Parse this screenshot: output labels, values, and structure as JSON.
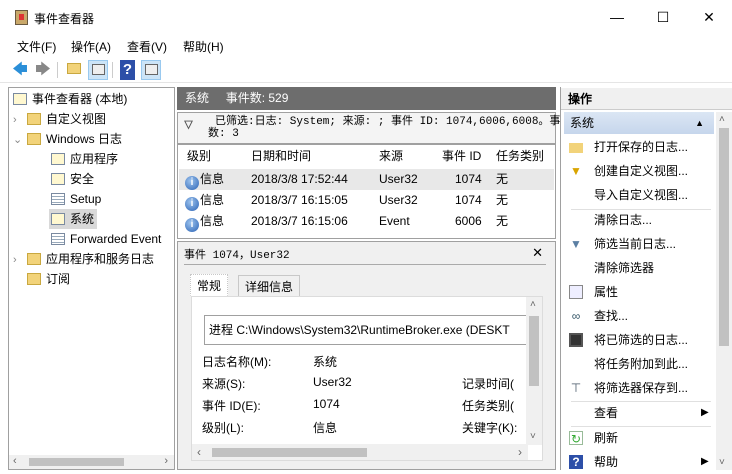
{
  "window": {
    "title": "事件查看器",
    "minimize": "—",
    "maximize": "☐",
    "close": "✕"
  },
  "menu": [
    "文件(F)",
    "操作(A)",
    "查看(V)",
    "帮助(H)"
  ],
  "toolbar": {
    "back": "🡄",
    "forward": "🡆",
    "help": "?"
  },
  "tree": {
    "root": "事件查看器 (本地)",
    "custom_views": "自定义视图",
    "windows_logs": "Windows 日志",
    "logs": [
      "应用程序",
      "安全",
      "Setup",
      "系统",
      "Forwarded Event"
    ],
    "app_service_logs": "应用程序和服务日志",
    "subscriptions": "订阅"
  },
  "middle": {
    "log_name": "系统",
    "event_count": "事件数: 529",
    "filter_line1": "已筛选:日志: System; 来源: ; 事件 ID: 1074,6006,6008。事",
    "filter_line2": "数: 3",
    "columns": [
      "级别",
      "日期和时间",
      "来源",
      "事件 ID",
      "任务类别"
    ],
    "rows": [
      {
        "level": "信息",
        "datetime": "2018/3/8 17:52:44",
        "source": "User32",
        "id": "1074",
        "task": "无"
      },
      {
        "level": "信息",
        "datetime": "2018/3/7 16:15:05",
        "source": "User32",
        "id": "1074",
        "task": "无"
      },
      {
        "level": "信息",
        "datetime": "2018/3/7 16:15:06",
        "source": "Event",
        "id": "6006",
        "task": "无"
      }
    ]
  },
  "detail": {
    "title": "事件 1074，User32",
    "close": "✕",
    "tabs": [
      "常规",
      "详细信息"
    ],
    "description": "进程 C:\\Windows\\System32\\RuntimeBroker.exe (DESKT",
    "fields": [
      {
        "label": "日志名称(M):",
        "value": "系统",
        "right": ""
      },
      {
        "label": "来源(S):",
        "value": "User32",
        "right": "记录时间("
      },
      {
        "label": "事件 ID(E):",
        "value": "1074",
        "right": "任务类别("
      },
      {
        "label": "级别(L):",
        "value": "信息",
        "right": "关键字(K):"
      }
    ]
  },
  "actions": {
    "header": "操作",
    "section": "系统",
    "items": [
      "打开保存的日志...",
      "创建自定义视图...",
      "导入自定义视图...",
      "清除日志...",
      "筛选当前日志...",
      "清除筛选器",
      "属性",
      "查找...",
      "将已筛选的日志...",
      "将任务附加到此...",
      "将筛选器保存到...",
      "查看",
      "刷新",
      "帮助"
    ]
  }
}
